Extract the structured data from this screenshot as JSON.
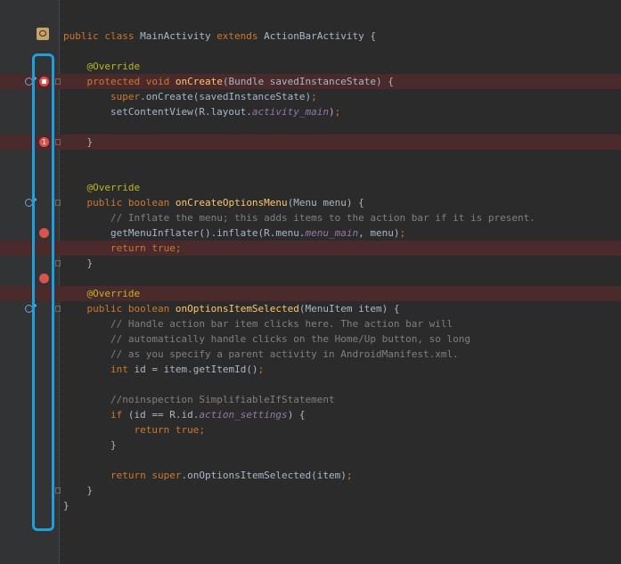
{
  "editor": {
    "language": "java",
    "colors": {
      "background": "#2b2b2b",
      "gutter": "#313335",
      "keyword": "#cc7832",
      "annotation": "#bbb529",
      "method": "#ffc66d",
      "comment": "#808080",
      "field": "#9876aa",
      "error_line": "#4b2a2c",
      "highlight_box": "#1f9fde",
      "breakpoint": "#d9534f"
    }
  },
  "gutter_markers": [
    {
      "line": 1,
      "icon": "class-file-icon"
    },
    {
      "line": 4,
      "icon": "breakpoint-verified-icon"
    },
    {
      "line": 8,
      "icon": "breakpoint-hit-icon",
      "label": "1"
    },
    {
      "line": 14,
      "icon": "breakpoint-icon"
    },
    {
      "line": 17,
      "icon": "breakpoint-icon"
    }
  ],
  "lines": [
    {
      "n": 1,
      "tokens": [
        [
          "kw",
          "public class "
        ],
        [
          "",
          "MainActivity "
        ],
        [
          "kw",
          "extends "
        ],
        [
          "",
          "ActionBarActivity {"
        ]
      ]
    },
    {
      "n": 2,
      "tokens": []
    },
    {
      "n": 3,
      "tokens": [
        [
          "",
          "    "
        ],
        [
          "an",
          "@Override"
        ]
      ]
    },
    {
      "n": 4,
      "err": true,
      "tokens": [
        [
          "",
          "    "
        ],
        [
          "kw",
          "protected void "
        ],
        [
          "fn",
          "onCreate"
        ],
        [
          "",
          "(Bundle savedInstanceState) {"
        ]
      ]
    },
    {
      "n": 5,
      "tokens": [
        [
          "",
          "        "
        ],
        [
          "kw",
          "super"
        ],
        [
          "",
          ".onCreate(savedInstanceState)"
        ],
        [
          "kw",
          ";"
        ]
      ]
    },
    {
      "n": 6,
      "tokens": [
        [
          "",
          "        setContentView(R.layout."
        ],
        [
          "fl",
          "activity_main"
        ],
        [
          "",
          ")"
        ],
        [
          "kw",
          ";"
        ]
      ]
    },
    {
      "n": 7,
      "tokens": []
    },
    {
      "n": 8,
      "err": true,
      "tokens": [
        [
          "",
          "    }"
        ]
      ]
    },
    {
      "n": 9,
      "tokens": []
    },
    {
      "n": 10,
      "tokens": []
    },
    {
      "n": 11,
      "tokens": [
        [
          "",
          "    "
        ],
        [
          "an",
          "@Override"
        ]
      ]
    },
    {
      "n": 12,
      "tokens": [
        [
          "",
          "    "
        ],
        [
          "kw",
          "public boolean "
        ],
        [
          "fn",
          "onCreateOptionsMenu"
        ],
        [
          "",
          "(Menu menu) {"
        ]
      ]
    },
    {
      "n": 13,
      "tokens": [
        [
          "",
          "        "
        ],
        [
          "cm",
          "// Inflate the menu; this adds items to the action bar if it is present."
        ]
      ]
    },
    {
      "n": 14,
      "tokens": [
        [
          "",
          "        getMenuInflater().inflate(R.menu."
        ],
        [
          "fl",
          "menu_main"
        ],
        [
          "",
          ", menu)"
        ],
        [
          "kw",
          ";"
        ]
      ]
    },
    {
      "n": 15,
      "err": true,
      "tokens": [
        [
          "",
          "        "
        ],
        [
          "kw",
          "return true;"
        ]
      ]
    },
    {
      "n": 16,
      "tokens": [
        [
          "",
          "    }"
        ]
      ]
    },
    {
      "n": 17,
      "tokens": []
    },
    {
      "n": 18,
      "err": true,
      "tokens": [
        [
          "",
          "    "
        ],
        [
          "an",
          "@Override"
        ]
      ]
    },
    {
      "n": 19,
      "tokens": [
        [
          "",
          "    "
        ],
        [
          "kw",
          "public boolean "
        ],
        [
          "fn",
          "onOptionsItemSelected"
        ],
        [
          "",
          "(MenuItem item) {"
        ]
      ]
    },
    {
      "n": 20,
      "tokens": [
        [
          "",
          "        "
        ],
        [
          "cm",
          "// Handle action bar item clicks here. The action bar will"
        ]
      ]
    },
    {
      "n": 21,
      "tokens": [
        [
          "",
          "        "
        ],
        [
          "cm",
          "// automatically handle clicks on the Home/Up button, so long"
        ]
      ]
    },
    {
      "n": 22,
      "tokens": [
        [
          "",
          "        "
        ],
        [
          "cm",
          "// as you specify a parent activity in AndroidManifest.xml."
        ]
      ]
    },
    {
      "n": 23,
      "tokens": [
        [
          "",
          "        "
        ],
        [
          "kw",
          "int "
        ],
        [
          "",
          "id = item.getItemId()"
        ],
        [
          "kw",
          ";"
        ]
      ]
    },
    {
      "n": 24,
      "tokens": []
    },
    {
      "n": 25,
      "tokens": [
        [
          "",
          "        "
        ],
        [
          "cm",
          "//noinspection SimplifiableIfStatement"
        ]
      ]
    },
    {
      "n": 26,
      "tokens": [
        [
          "",
          "        "
        ],
        [
          "kw",
          "if "
        ],
        [
          "",
          "(id == R.id."
        ],
        [
          "fl",
          "action_settings"
        ],
        [
          "",
          ") {"
        ]
      ]
    },
    {
      "n": 27,
      "tokens": [
        [
          "",
          "            "
        ],
        [
          "kw",
          "return true;"
        ]
      ]
    },
    {
      "n": 28,
      "tokens": [
        [
          "",
          "        }"
        ]
      ]
    },
    {
      "n": 29,
      "tokens": []
    },
    {
      "n": 30,
      "tokens": [
        [
          "",
          "        "
        ],
        [
          "kw",
          "return super"
        ],
        [
          "",
          "."
        ],
        [
          "",
          "onOptionsItemSelected(item)"
        ],
        [
          "kw",
          ";"
        ]
      ]
    },
    {
      "n": 31,
      "tokens": [
        [
          "",
          "    }"
        ]
      ]
    },
    {
      "n": 32,
      "tokens": [
        [
          "",
          "}"
        ]
      ]
    }
  ]
}
